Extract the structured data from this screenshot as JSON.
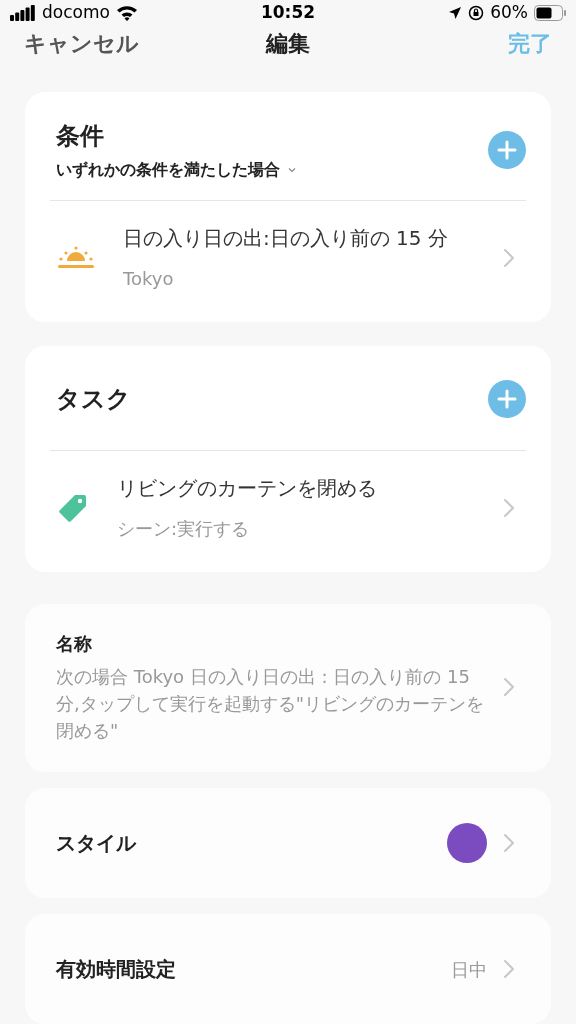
{
  "status_bar": {
    "carrier": "docomo",
    "time": "10:52",
    "battery": "60%"
  },
  "nav": {
    "cancel": "キャンセル",
    "title": "編集",
    "done": "完了"
  },
  "conditions": {
    "title": "条件",
    "mode": "いずれかの条件を満たした場合",
    "items": [
      {
        "kind": "sunset",
        "title": "日の入り日の出:日の入り前の 15 分",
        "subtitle": "Tokyo"
      }
    ]
  },
  "tasks": {
    "title": "タスク",
    "items": [
      {
        "kind": "scene",
        "title": "リビングのカーテンを閉める",
        "subtitle": "シーン:実行する"
      }
    ]
  },
  "name": {
    "label": "名称",
    "value": "次の場合 Tokyo 日の入り日の出 : 日の入り前の 15 分,タップして実行を起動する\"リビングのカーテンを閉める\""
  },
  "style": {
    "label": "スタイル",
    "color": "#7a4cc0"
  },
  "validity": {
    "label": "有効時間設定",
    "value": "日中"
  }
}
